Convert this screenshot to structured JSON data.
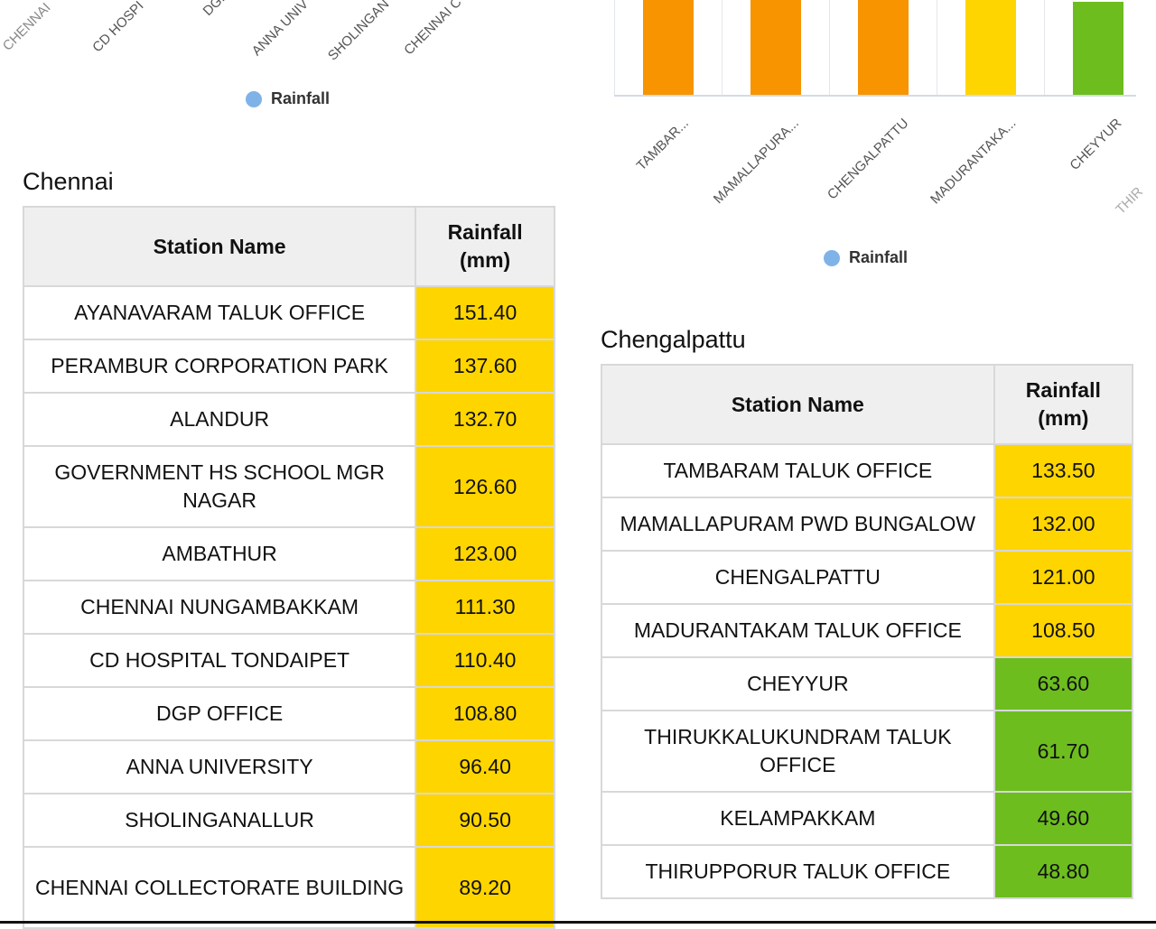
{
  "colors": {
    "orange": "#f79400",
    "yellow": "#ffd500",
    "green": "#6dbd1f",
    "legend_dot": "#7fb3e8",
    "header_bg": "#efefef",
    "border": "#d8d8d8"
  },
  "left_chart": {
    "x_labels_visible": [
      "CHENNAI",
      "CD HOSPI",
      "DGP",
      "ANNA UNIV",
      "SHOLINGAN",
      "CHENNAI C"
    ],
    "legend": "Rainfall"
  },
  "right_chart": {
    "x_labels_visible": [
      "TAMBAR...",
      "MAMALLAPURA...",
      "CHENGALPATTU",
      "MADURANTAKA...",
      "CHEYYUR",
      "THIR"
    ],
    "legend": "Rainfall"
  },
  "chart_data": {
    "type": "bar",
    "title": "",
    "xlabel": "",
    "ylabel": "",
    "legend": [
      "Rainfall"
    ],
    "legend_position": "bottom",
    "categories": [
      "TAMBAR...",
      "MAMALLAPURA...",
      "CHENGALPATTU",
      "MADURANTAKA...",
      "CHEYYUR"
    ],
    "values": [
      133.5,
      132.0,
      121.0,
      108.5,
      63.6
    ],
    "bar_colors": [
      "#f79400",
      "#f79400",
      "#f79400",
      "#ffd500",
      "#6dbd1f"
    ],
    "note": "Bar tops are cropped above the visible area; values taken from the Chengalpattu table."
  },
  "chennai": {
    "title": "Chennai",
    "headers": [
      "Station Name",
      "Rainfall (mm)"
    ],
    "header_rainfall_line1": "Rainfall",
    "header_rainfall_line2": "(mm)",
    "rows": [
      {
        "name": "AYANAVARAM TALUK OFFICE",
        "value": "151.40",
        "color": "#ffd500"
      },
      {
        "name": "PERAMBUR CORPORATION PARK",
        "value": "137.60",
        "color": "#ffd500"
      },
      {
        "name": "ALANDUR",
        "value": "132.70",
        "color": "#ffd500"
      },
      {
        "name": "GOVERNMENT HS SCHOOL MGR NAGAR",
        "value": "126.60",
        "color": "#ffd500"
      },
      {
        "name": "AMBATHUR",
        "value": "123.00",
        "color": "#ffd500"
      },
      {
        "name": "CHENNAI NUNGAMBAKKAM",
        "value": "111.30",
        "color": "#ffd500"
      },
      {
        "name": "CD HOSPITAL TONDAIPET",
        "value": "110.40",
        "color": "#ffd500"
      },
      {
        "name": "DGP OFFICE",
        "value": "108.80",
        "color": "#ffd500"
      },
      {
        "name": "ANNA UNIVERSITY",
        "value": "96.40",
        "color": "#ffd500"
      },
      {
        "name": "SHOLINGANALLUR",
        "value": "90.50",
        "color": "#ffd500"
      },
      {
        "name": "CHENNAI COLLECTORATE BUILDING",
        "value": "89.20",
        "color": "#ffd500"
      }
    ]
  },
  "chengalpattu": {
    "title": "Chengalpattu",
    "headers": [
      "Station Name",
      "Rainfall (mm)"
    ],
    "header_rainfall_line1": "Rainfall",
    "header_rainfall_line2": "(mm)",
    "rows": [
      {
        "name": "TAMBARAM TALUK OFFICE",
        "value": "133.50",
        "color": "#ffd500"
      },
      {
        "name": "MAMALLAPURAM PWD BUNGALOW",
        "value": "132.00",
        "color": "#ffd500"
      },
      {
        "name": "CHENGALPATTU",
        "value": "121.00",
        "color": "#ffd500"
      },
      {
        "name": "MADURANTAKAM TALUK OFFICE",
        "value": "108.50",
        "color": "#ffd500"
      },
      {
        "name": "CHEYYUR",
        "value": "63.60",
        "color": "#6dbd1f"
      },
      {
        "name": "THIRUKKALUKUNDRAM TALUK OFFICE",
        "value": "61.70",
        "color": "#6dbd1f"
      },
      {
        "name": "KELAMPAKKAM",
        "value": "49.60",
        "color": "#6dbd1f"
      },
      {
        "name": "THIRUPPORUR TALUK OFFICE",
        "value": "48.80",
        "color": "#6dbd1f"
      }
    ]
  }
}
